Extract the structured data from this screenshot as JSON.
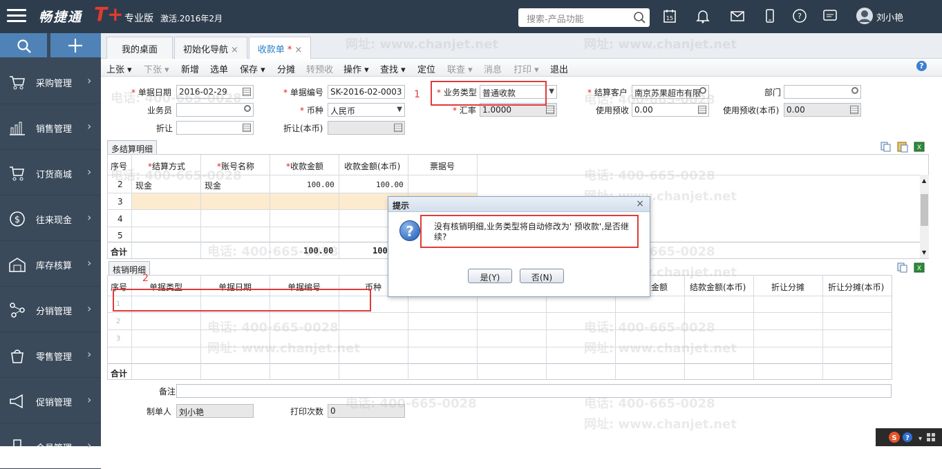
{
  "app": {
    "logo_text": "畅捷通",
    "logo_mark": "T+",
    "edition": "专业版",
    "activation": "激活.2016年2月",
    "search_placeholder": "搜索-产品功能",
    "user_name": "刘小艳"
  },
  "sidebar": {
    "items": [
      {
        "label": "采购管理",
        "icon": "cart-icon"
      },
      {
        "label": "销售管理",
        "icon": "bar-chart-icon"
      },
      {
        "label": "订货商城",
        "icon": "shopping-cart-icon"
      },
      {
        "label": "往来现金",
        "icon": "dollar-icon"
      },
      {
        "label": "库存核算",
        "icon": "warehouse-icon"
      },
      {
        "label": "分销管理",
        "icon": "distribution-icon"
      },
      {
        "label": "零售管理",
        "icon": "retail-icon"
      },
      {
        "label": "促销管理",
        "icon": "megaphone-icon"
      },
      {
        "label": "会员管理",
        "icon": "member-icon"
      }
    ]
  },
  "tabs": [
    {
      "label": "我的桌面"
    },
    {
      "label": "初始化导航"
    },
    {
      "label": "收款单",
      "modified": "*"
    }
  ],
  "toolbar": {
    "up": "上张",
    "down": "下张",
    "add": "新增",
    "select": "选单",
    "save": "保存",
    "split": "分摊",
    "to_prepay": "转预收",
    "operate": "操作",
    "find": "查找",
    "locate": "定位",
    "linked": "联查",
    "message": "消息",
    "print": "打印",
    "exit": "退出"
  },
  "form": {
    "doc_date_label": "单据日期",
    "doc_date": "2016-02-29",
    "doc_no_label": "单据编号",
    "doc_no": "SK-2016-02-0003",
    "biz_type_label": "业务类型",
    "biz_type": "普通收款",
    "customer_label": "结算客户",
    "customer": "南京苏果超市有限",
    "dept_label": "部门",
    "dept": "",
    "salesman_label": "业务员",
    "salesman": "",
    "currency_label": "币种",
    "currency": "人民币",
    "rate_label": "汇率",
    "rate": "1.0000",
    "use_prepay_label": "使用预收",
    "use_prepay": "0.00",
    "use_prepay_local_label": "使用预收(本币)",
    "use_prepay_local": "0.00",
    "discount_label": "折让",
    "discount": "",
    "discount_local_label": "折让(本币)",
    "discount_local": ""
  },
  "settle_grid": {
    "tab": "多结算明细",
    "headers": [
      "序号",
      "结算方式",
      "账号名称",
      "收款金额",
      "收款金额(本币)",
      "票据号"
    ],
    "rows": [
      {
        "no": "2",
        "method": "现金",
        "account": "现金",
        "amount": "100.00",
        "amount_local": "100.00",
        "bill": ""
      },
      {
        "no": "3",
        "method": "",
        "account": "",
        "amount": "",
        "amount_local": "",
        "bill": ""
      },
      {
        "no": "4",
        "method": "",
        "account": "",
        "amount": "",
        "amount_local": "",
        "bill": ""
      },
      {
        "no": "5",
        "method": "",
        "account": "",
        "amount": "",
        "amount_local": "",
        "bill": ""
      }
    ],
    "total_label": "合计",
    "total_amount": "100.00",
    "total_amount_local": "100"
  },
  "writeoff_grid": {
    "tab": "核销明细",
    "headers": [
      "序号",
      "单据类型",
      "单据日期",
      "单据编号",
      "币种",
      "金额",
      "结款金额(本币)",
      "折让分摊",
      "折让分摊(本币)"
    ],
    "rows": [
      "1",
      "2",
      "3"
    ],
    "total_label": "合计"
  },
  "footer": {
    "remark_label": "备注",
    "remark": "",
    "maker_label": "制单人",
    "maker": "刘小艳",
    "print_count_label": "打印次数",
    "print_count": "0"
  },
  "dialog": {
    "title": "提示",
    "message": "没有核销明细,业务类型将自动修改为' 预收款',是否继续?",
    "yes": "是(Y)",
    "no": "否(N)"
  },
  "annotations": {
    "one": "1",
    "two": "2"
  },
  "watermark": {
    "phone": "电话: 400-665-0028",
    "site": "网址: www.chanjet.net"
  },
  "colors": {
    "accent": "#2a7fc8",
    "sidebar": "#3a4a5b",
    "topbar": "#2e3d4d",
    "highlight": "#e03a3a"
  }
}
